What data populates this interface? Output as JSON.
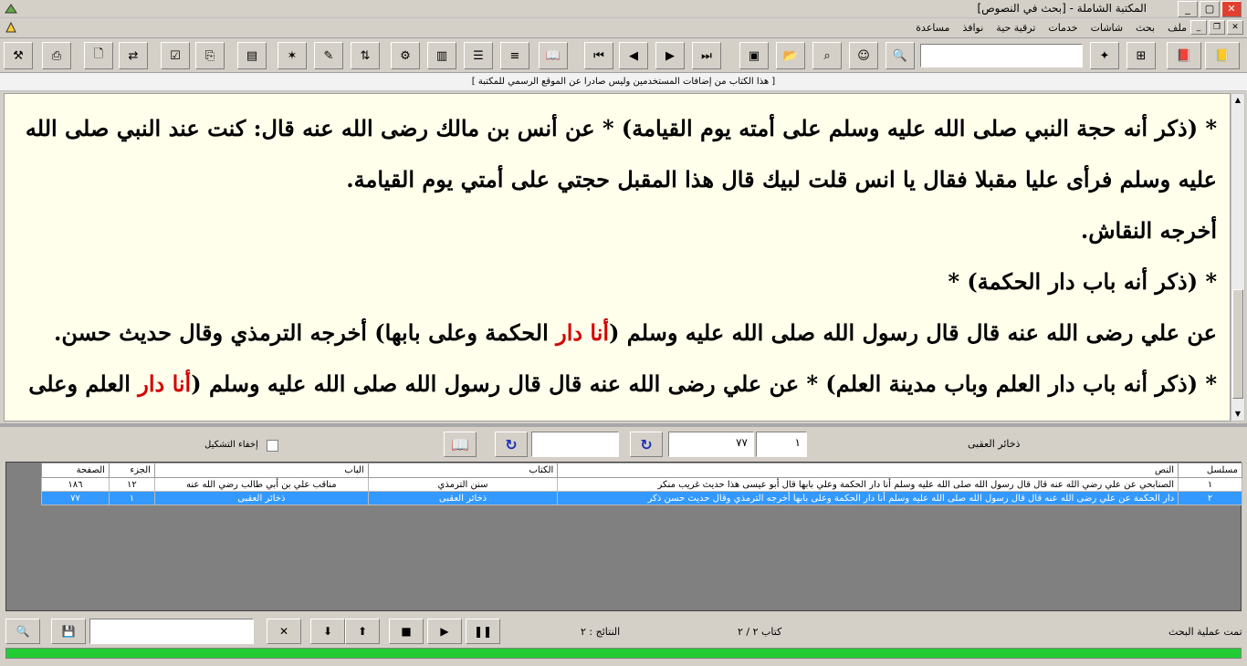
{
  "window": {
    "title": "المكتبة الشاملة - [بحث في النصوص]",
    "buttons": [
      "_",
      "▢",
      "✕"
    ]
  },
  "menu": {
    "items": [
      "ملف",
      "بحث",
      "شاشات",
      "خدمات",
      "ترقية حية",
      "نوافذ",
      "مساعدة"
    ]
  },
  "notice": "[ هذا الكتاب من إضافات المستخدمين وليس صادرا عن الموقع الرسمي للمكتبة ]",
  "reader": {
    "p1": "* (ذكر أنه حجة النبي صلى الله عليه وسلم على أمته يوم القيامة) * عن أنس بن مالك رضى الله عنه قال: كنت عند النبي صلى الله عليه وسلم فرأى عليا مقبلا فقال يا انس قلت لبيك قال هذا المقبل حجتي على أمتي يوم القيامة.",
    "p2": "أخرجه النقاش.",
    "p3": "* (ذكر أنه باب دار الحكمة) *",
    "p4a": "عن علي رضى الله عنه قال قال رسول الله صلى الله عليه وسلم (",
    "p4hl": "أنا دار",
    "p4b": " الحكمة وعلى بابها) أخرجه الترمذي وقال حديث حسن.",
    "p5a": "* (ذكر أنه باب دار العلم وباب مدينة العلم) * عن علي رضى الله عنه قال قال رسول الله صلى الله عليه وسلم (",
    "p5hl": "أنا دار",
    "p5b": " العلم وعلى"
  },
  "controls": {
    "book_name": "ذخائر العقبى",
    "page_from": "١",
    "page_value": "٧٧",
    "hide_diacritics_label": "إخفاء التشكيل"
  },
  "results": {
    "columns": [
      "مسلسل",
      "النص",
      "الكتاب",
      "الباب",
      "الجزء",
      "الصفحة"
    ],
    "rows": [
      {
        "num": "١",
        "text": "الصنابحي عن علي رضي الله عنه قال قال رسول الله صلى الله عليه وسلم أنا دار الحكمة وعلي بابها قال أبو عيسى هذا حديث غريب منكر",
        "book": "سنن الترمذي",
        "chapter": "مناقب علي بن أبي طالب رضي الله عنه",
        "part": "١٢",
        "page": "١٨٦"
      },
      {
        "num": "٢",
        "text": "دار الحكمة عن علي رضى الله عنه قال قال رسول الله صلى الله عليه وسلم أنا دار الحكمة وعلى بابها أخرجه الترمذي وقال حديث حسن ذكر",
        "book": "ذخائر العقبى",
        "chapter": "ذخائر العقبى",
        "part": "١",
        "page": "٧٧"
      }
    ]
  },
  "status": {
    "done": "تمت عملية البحث",
    "books": "كتاب ٢ / ٢",
    "results": "النتائج : ٢"
  },
  "progress": 1.0,
  "colors": {
    "highlight": "#d40000",
    "selection": "#3399ff",
    "progress": "#22cc33",
    "reader_bg": "#ffffeb"
  }
}
